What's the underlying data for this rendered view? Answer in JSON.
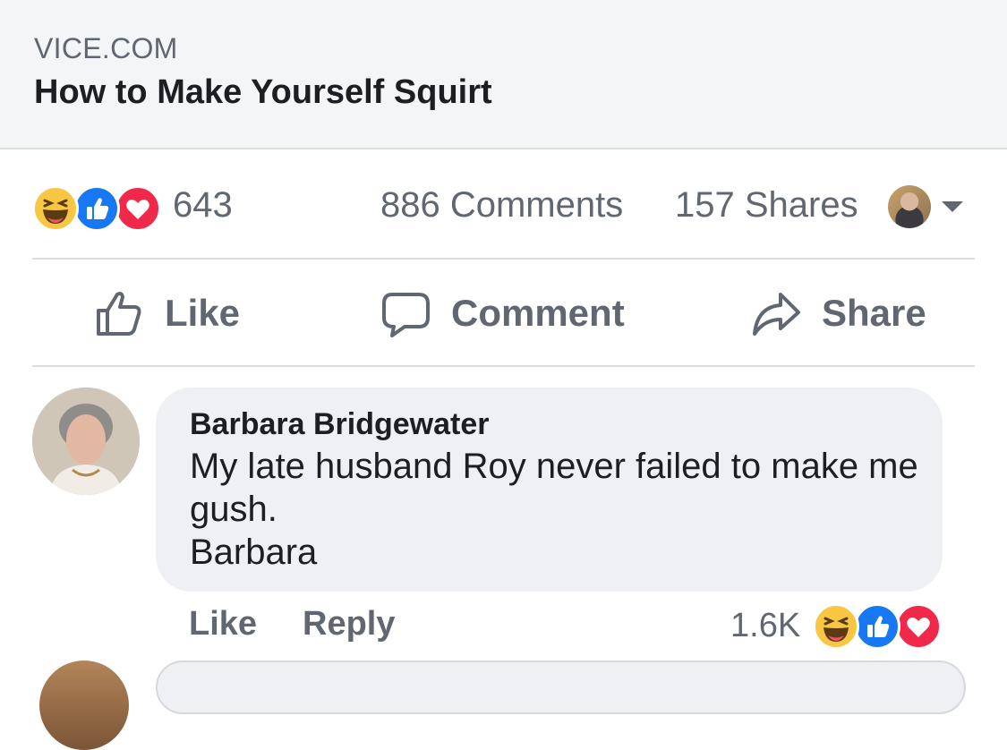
{
  "link_preview": {
    "domain": "VICE.COM",
    "title": "How to Make Yourself Squirt"
  },
  "stats": {
    "reaction_icons": [
      "haha-icon",
      "like-icon",
      "love-icon"
    ],
    "reaction_count": "643",
    "comments": "886 Comments",
    "shares": "157 Shares"
  },
  "actions": {
    "like": "Like",
    "comment": "Comment",
    "share": "Share"
  },
  "comment": {
    "author": "Barbara Bridgewater",
    "text": "My late husband Roy never failed to make me gush.",
    "signature": "Barbara",
    "like_label": "Like",
    "reply_label": "Reply",
    "reaction_count": "1.6K",
    "reaction_icons": [
      "haha-icon",
      "like-icon",
      "love-icon"
    ]
  },
  "colors": {
    "like_blue": "#1877f2",
    "love_red": "#f02849",
    "haha_yellow": "#f7c744",
    "muted_text": "#606770",
    "bubble_bg": "#eff0f4"
  }
}
